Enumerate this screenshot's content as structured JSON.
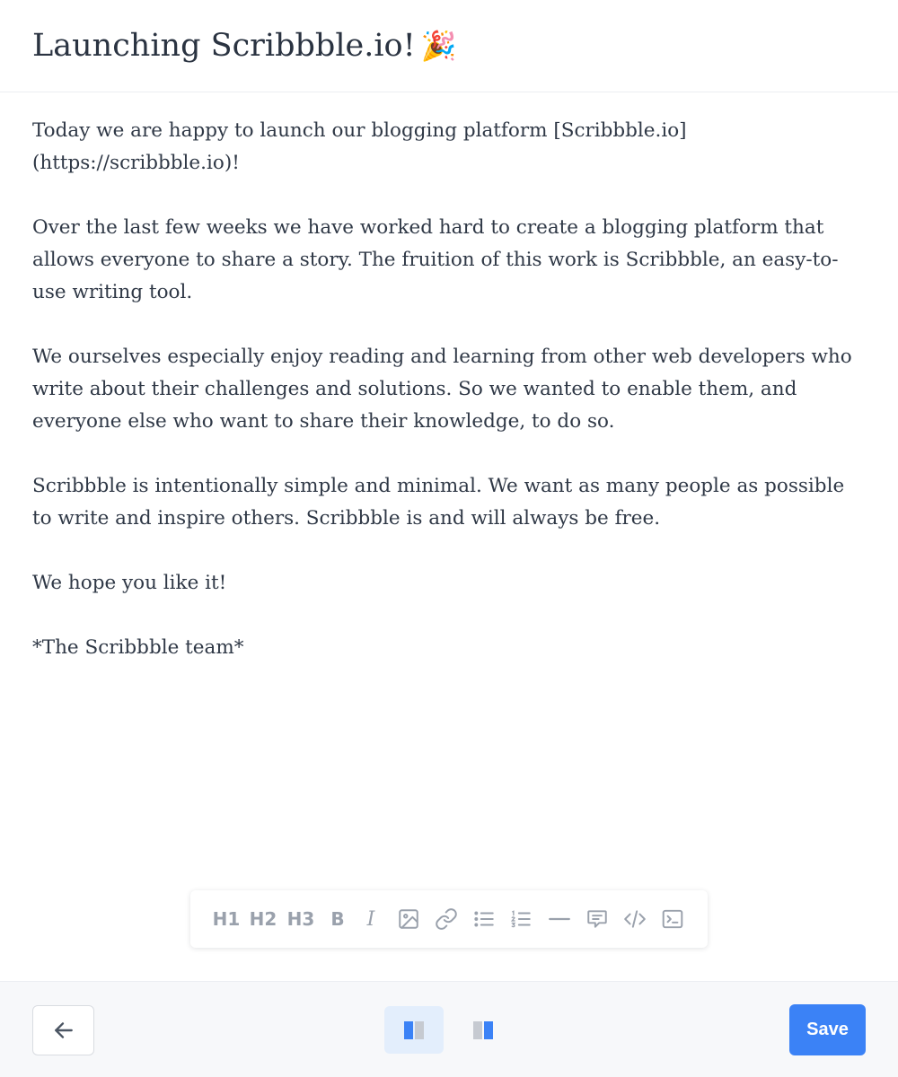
{
  "post": {
    "title": "Launching Scribbble.io!",
    "title_emoji": "🎉",
    "paragraphs": [
      "Today we are happy to launch our blogging platform [Scribbble.io](https://scribbble.io)!",
      "Over the last few weeks we have worked hard to create a blogging platform that allows everyone to share a story. The fruition of this work is Scribbble, an easy-to-use writing tool.",
      "We ourselves especially enjoy reading and learning from other web developers who write about their challenges and solutions. So we wanted to enable them, and everyone else who want to share their knowledge, to do so.",
      "Scribbble is intentionally simple and minimal. We want as many people as possible to write and inspire others. Scribbble is and will always be free.",
      "We hope you like it!",
      "*The Scribbble team*"
    ]
  },
  "toolbar": {
    "h1": "H1",
    "h2": "H2",
    "h3": "H3",
    "bold": "B",
    "italic": "I",
    "icons": [
      "image-icon",
      "link-icon",
      "bullet-list-icon",
      "numbered-list-icon",
      "horizontal-rule-icon",
      "quote-icon",
      "code-icon",
      "code-block-icon"
    ]
  },
  "footer": {
    "save_label": "Save",
    "icons": [
      "arrow-left-icon",
      "split-view-icon",
      "preview-view-icon"
    ]
  },
  "colors": {
    "accent": "#3b82f6",
    "toolbar_icon": "#9aa1ac",
    "text": "#2f3846"
  }
}
